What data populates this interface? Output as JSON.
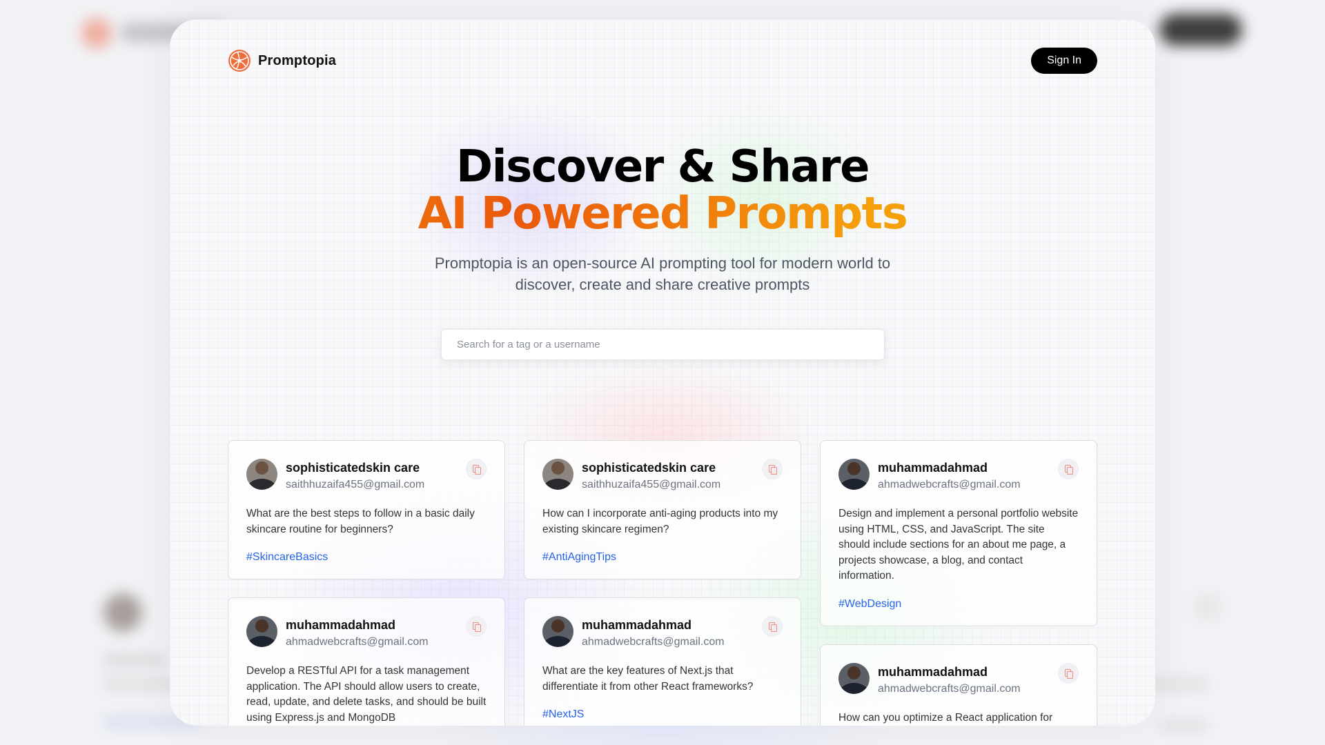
{
  "app": {
    "brand_name": "Promptopia",
    "signin_label": "Sign In"
  },
  "hero": {
    "line1": "Discover & Share",
    "line2": "AI Powered Prompts",
    "subtitle": "Promptopia is an open-source AI prompting tool for modern world to discover, create and share creative prompts"
  },
  "search": {
    "placeholder": "Search for a tag or a username",
    "value": ""
  },
  "icons": {
    "logo": "logo-icon",
    "copy": "copy-icon"
  },
  "colors": {
    "accent_gradient": [
      "#f59e0b",
      "#ea580c",
      "#eab308"
    ],
    "tag_color": "#2563eb",
    "button_bg": "#000000"
  },
  "columns": [
    {
      "cards": [
        {
          "username": "sophisticatedskin care",
          "email": "saithhuzaifa455@gmail.com",
          "prompt": "What are the best steps to follow in a basic daily skincare routine for beginners?",
          "tag": "#SkincareBasics"
        },
        {
          "username": "muhammadahmad",
          "email": "ahmadwebcrafts@gmail.com",
          "prompt": "Develop a RESTful API for a task management application. The API should allow users to create, read, update, and delete tasks, and should be built using Express.js and MongoDB",
          "tag": ""
        }
      ]
    },
    {
      "cards": [
        {
          "username": "sophisticatedskin care",
          "email": "saithhuzaifa455@gmail.com",
          "prompt": "How can I incorporate anti-aging products into my existing skincare regimen?",
          "tag": "#AntiAgingTips"
        },
        {
          "username": "muhammadahmad",
          "email": "ahmadwebcrafts@gmail.com",
          "prompt": "What are the key features of Next.js that differentiate it from other React frameworks?",
          "tag": "#NextJS"
        }
      ]
    },
    {
      "cards": [
        {
          "username": "muhammadahmad",
          "email": "ahmadwebcrafts@gmail.com",
          "prompt": "Design and implement a personal portfolio website using HTML, CSS, and JavaScript. The site should include sections for an about me page, a projects showcase, a blog, and contact information.",
          "tag": "#WebDesign"
        },
        {
          "username": "muhammadahmad",
          "email": "ahmadwebcrafts@gmail.com",
          "prompt": "How can you optimize a React application for",
          "tag": ""
        }
      ]
    }
  ]
}
